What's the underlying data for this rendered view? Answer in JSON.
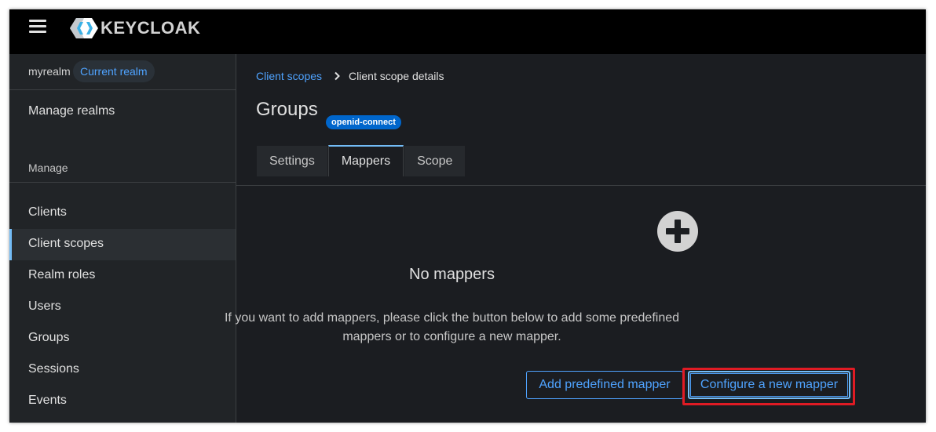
{
  "masthead": {
    "brand_text": "KEYCLOAK",
    "menu_icon": "hamburger-menu-icon"
  },
  "sidebar": {
    "realm_name": "myrealm",
    "realm_badge": "Current realm",
    "manage_realms": "Manage realms",
    "section_title": "Manage",
    "items": [
      {
        "label": "Clients",
        "active": false
      },
      {
        "label": "Client scopes",
        "active": true
      },
      {
        "label": "Realm roles",
        "active": false
      },
      {
        "label": "Users",
        "active": false
      },
      {
        "label": "Groups",
        "active": false
      },
      {
        "label": "Sessions",
        "active": false
      },
      {
        "label": "Events",
        "active": false
      }
    ]
  },
  "breadcrumb": {
    "parent": "Client scopes",
    "current": "Client scope details"
  },
  "page": {
    "title": "Groups",
    "protocol_label": "openid-connect"
  },
  "tabs": [
    {
      "label": "Settings",
      "active": false
    },
    {
      "label": "Mappers",
      "active": true
    },
    {
      "label": "Scope",
      "active": false
    }
  ],
  "empty_state": {
    "icon": "plus-circle-icon",
    "title": "No mappers",
    "body_line1": "If you want to add mappers, please click the button below to add some predefined",
    "body_line2": "mappers or to configure a new mapper.",
    "add_predefined": "Add predefined mapper",
    "configure_new": "Configure a new mapper"
  },
  "colors": {
    "accent": "#4fa3ff",
    "active_indicator": "#73bcf7",
    "highlight": "#e01b24",
    "label_bg": "#0066cc"
  }
}
